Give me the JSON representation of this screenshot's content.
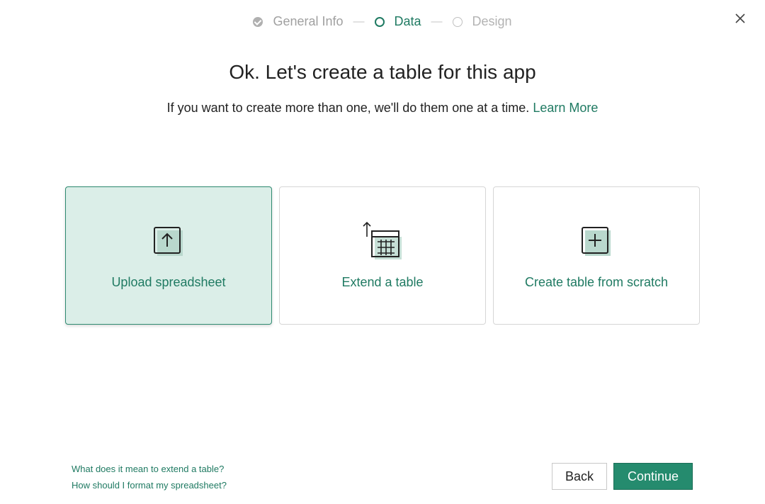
{
  "stepper": {
    "steps": [
      {
        "label": "General Info",
        "state": "done"
      },
      {
        "label": "Data",
        "state": "active"
      },
      {
        "label": "Design",
        "state": "pending"
      }
    ],
    "separator": "—"
  },
  "header": {
    "title": "Ok. Let's create a table for this app",
    "subtitle": "If you want to create more than one, we'll do them one at a time.",
    "learn_more": "Learn More"
  },
  "options": [
    {
      "label": "Upload spreadsheet",
      "icon": "upload-icon",
      "selected": true
    },
    {
      "label": "Extend a table",
      "icon": "extend-table-icon",
      "selected": false
    },
    {
      "label": "Create table from scratch",
      "icon": "add-table-icon",
      "selected": false
    }
  ],
  "help_links": [
    "What does it mean to extend a table?",
    "How should I format my spreadsheet?"
  ],
  "footer": {
    "back_label": "Back",
    "continue_label": "Continue"
  },
  "colors": {
    "accent": "#1f7a62",
    "primary_button": "#258b6e",
    "selected_card_bg": "#dbeee8"
  }
}
